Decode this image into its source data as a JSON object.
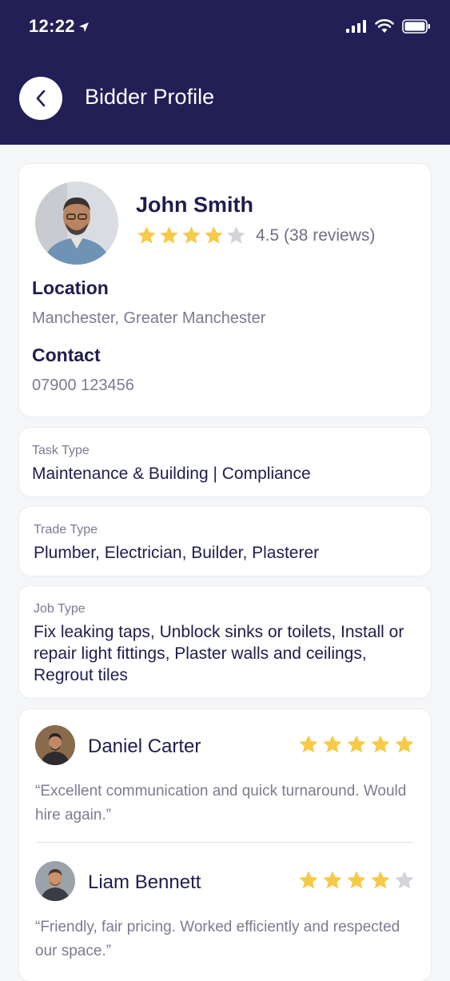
{
  "status_bar": {
    "time": "12:22"
  },
  "header": {
    "title": "Bidder Profile"
  },
  "profile": {
    "name": "John Smith",
    "rating_value": 4.5,
    "rating_text": "4.5 (38 reviews)",
    "location_label": "Location",
    "location_value": "Manchester, Greater Manchester",
    "contact_label": "Contact",
    "contact_value": "07900 123456"
  },
  "task": {
    "label": "Task Type",
    "value": "Maintenance & Building | Compliance"
  },
  "trade": {
    "label": "Trade Type",
    "value": "Plumber, Electrician, Builder, Plasterer"
  },
  "job": {
    "label": "Job Type",
    "value": "Fix leaking taps, Unblock sinks or toilets, Install or repair light fittings, Plaster walls and ceilings, Regrout tiles"
  },
  "reviews": [
    {
      "name": "Daniel Carter",
      "stars": 5,
      "text": "“Excellent communication and quick turnaround. Would hire again.”"
    },
    {
      "name": "Liam Bennett",
      "stars": 4,
      "text": "“Friendly, fair pricing. Worked efficiently and respected our space.”"
    }
  ],
  "colors": {
    "header_bg": "#211f55",
    "star_filled": "#f7c948",
    "star_empty": "#d3d3d8",
    "text_dark": "#1f1d4d",
    "text_muted": "#7c7b90"
  }
}
